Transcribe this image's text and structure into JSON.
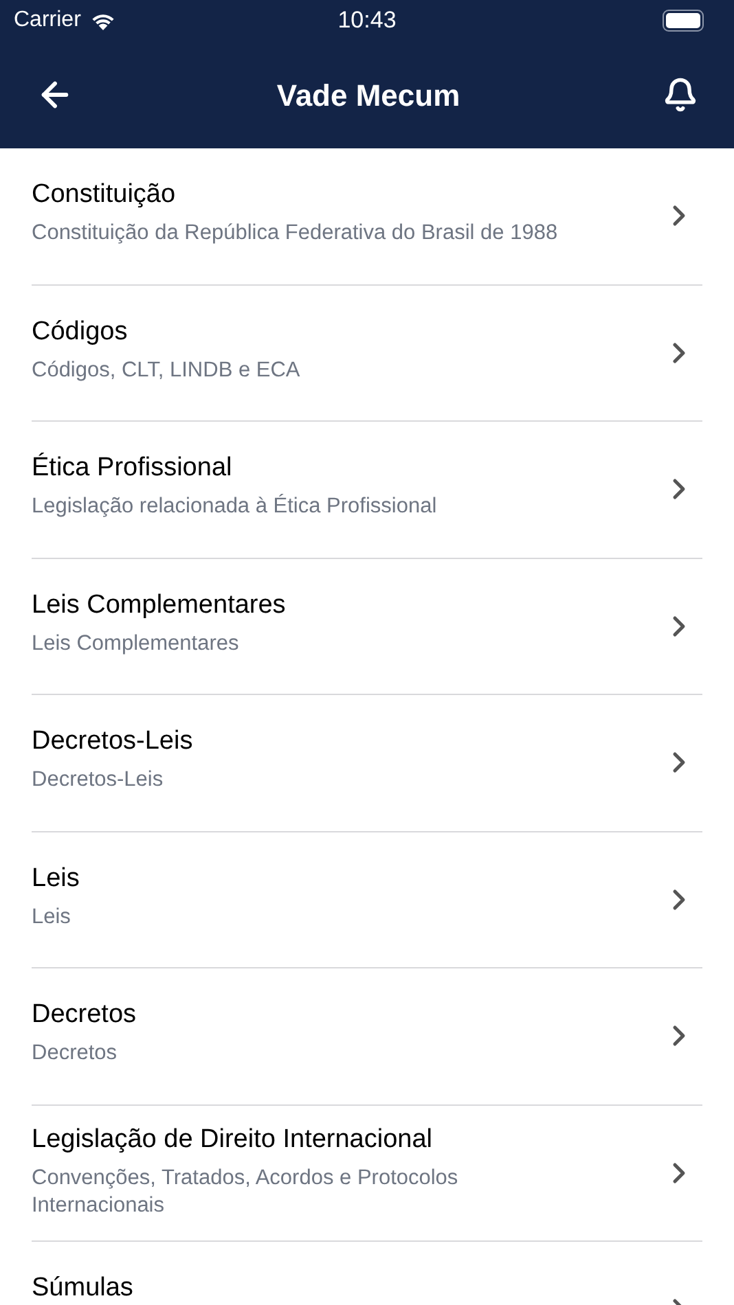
{
  "status_bar": {
    "carrier": "Carrier",
    "time": "10:43"
  },
  "nav": {
    "title": "Vade Mecum"
  },
  "items": [
    {
      "title": "Constituição",
      "subtitle": "Constituição da República Federativa do Brasil de 1988"
    },
    {
      "title": "Códigos",
      "subtitle": "Códigos, CLT, LINDB e ECA"
    },
    {
      "title": "Ética Profissional",
      "subtitle": "Legislação relacionada à Ética Profissional"
    },
    {
      "title": "Leis Complementares",
      "subtitle": "Leis Complementares"
    },
    {
      "title": "Decretos-Leis",
      "subtitle": "Decretos-Leis"
    },
    {
      "title": "Leis",
      "subtitle": "Leis"
    },
    {
      "title": "Decretos",
      "subtitle": "Decretos"
    },
    {
      "title": "Legislação de Direito Internacional",
      "subtitle": "Convenções, Tratados, Acordos e Protocolos Internacionais"
    },
    {
      "title": "Súmulas"
    }
  ]
}
